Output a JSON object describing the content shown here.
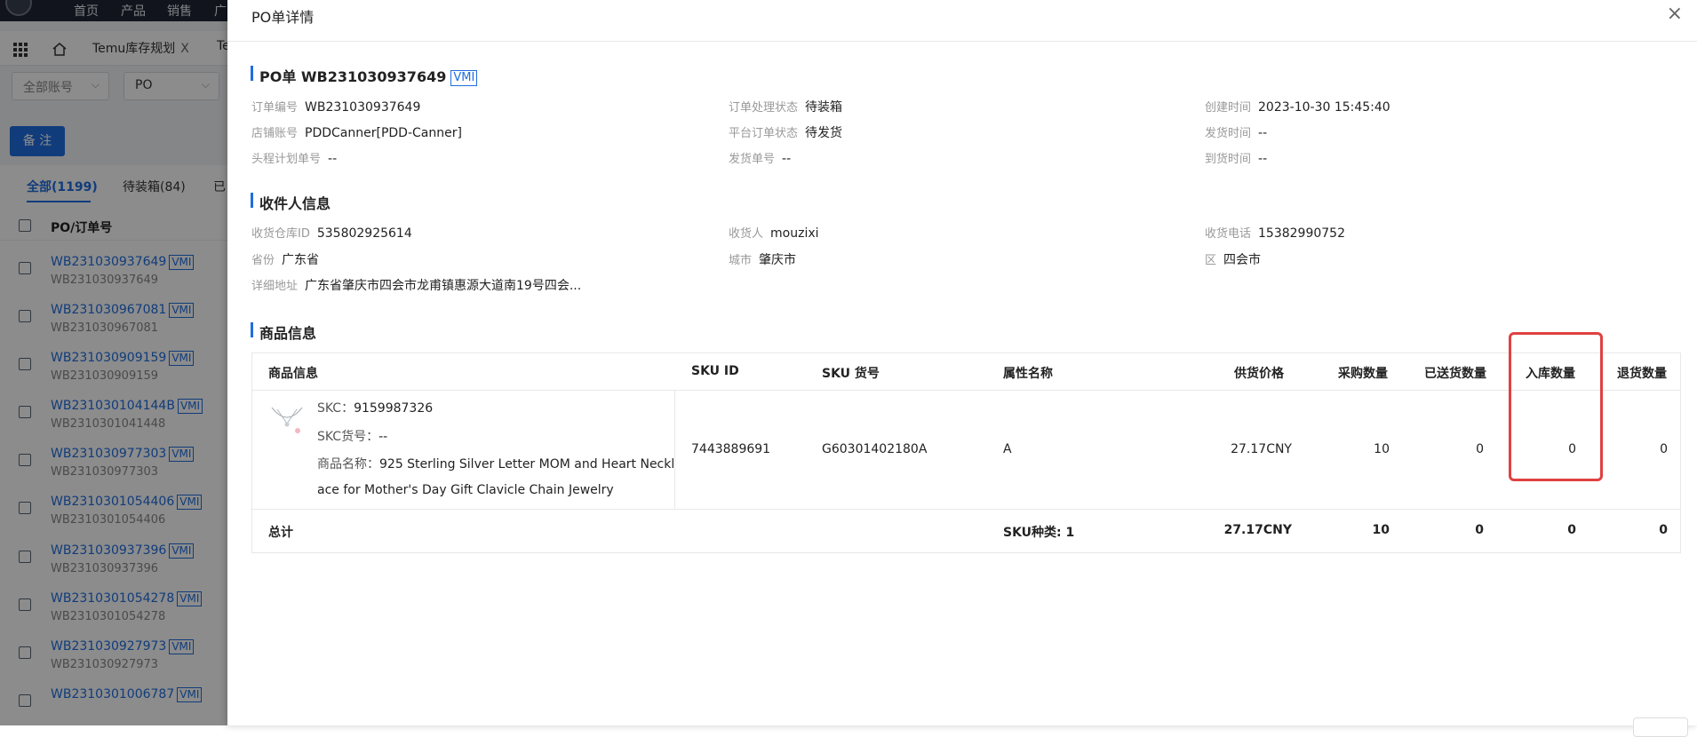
{
  "background": {
    "topnav": [
      "首页",
      "产品",
      "销售",
      "广"
    ],
    "tabs": [
      {
        "label": "Temu库存规划",
        "close": "X"
      },
      {
        "label": "Te"
      }
    ],
    "filters": [
      {
        "label": "全部账号"
      },
      {
        "label": "PO"
      }
    ],
    "note_button": "备 注",
    "status_tabs": [
      {
        "label": "全部(1199)"
      },
      {
        "label": "待装箱(84)"
      },
      {
        "label": "已"
      }
    ],
    "list_header": "PO/订单号",
    "vmi_tag": "VMI",
    "po_list": [
      {
        "po": "WB231030937649",
        "sub": "WB231030937649"
      },
      {
        "po": "WB231030967081",
        "sub": "WB231030967081"
      },
      {
        "po": "WB231030909159",
        "sub": "WB231030909159"
      },
      {
        "po": "WB231030104144B",
        "sub": "WB2310301041448"
      },
      {
        "po": "WB231030977303",
        "sub": "WB231030977303"
      },
      {
        "po": "WB2310301054406",
        "sub": "WB2310301054406"
      },
      {
        "po": "WB231030937396",
        "sub": "WB231030937396"
      },
      {
        "po": "WB2310301054278",
        "sub": "WB2310301054278"
      },
      {
        "po": "WB231030927973",
        "sub": "WB231030927973"
      },
      {
        "po": "WB2310301006787",
        "sub": ""
      }
    ]
  },
  "drawer": {
    "title": "PO单详情",
    "close": "×",
    "po_section": {
      "title": "PO单 WB231030937649",
      "tag": "VMI",
      "fields": [
        {
          "label": "订单编号",
          "value": "WB231030937649"
        },
        {
          "label": "订单处理状态",
          "value": "待装箱"
        },
        {
          "label": "创建时间",
          "value": "2023-10-30 15:45:40"
        },
        {
          "label": "店铺账号",
          "value": "PDDCanner[PDD-Canner]"
        },
        {
          "label": "平台订单状态",
          "value": "待发货"
        },
        {
          "label": "发货时间",
          "value": "--"
        },
        {
          "label": "头程计划单号",
          "value": "--"
        },
        {
          "label": "发货单号",
          "value": "--"
        },
        {
          "label": "到货时间",
          "value": "--"
        }
      ]
    },
    "receiver_section": {
      "title": "收件人信息",
      "fields": [
        {
          "label": "收货仓库ID",
          "value": "535802925614"
        },
        {
          "label": "收货人",
          "value": "mouzixi"
        },
        {
          "label": "收货电话",
          "value": "15382990752"
        },
        {
          "label": "省份",
          "value": "广东省"
        },
        {
          "label": "城市",
          "value": "肇庆市"
        },
        {
          "label": "区",
          "value": "四会市"
        },
        {
          "label": "详细地址",
          "value": "广东省肇庆市四会市龙甫镇惠源大道南19号四会..."
        }
      ]
    },
    "goods_section": {
      "title": "商品信息",
      "headers": [
        "商品信息",
        "SKU ID",
        "SKU 货号",
        "属性名称",
        "供货价格",
        "采购数量",
        "已送货数量",
        "入库数量",
        "退货数量"
      ],
      "row": {
        "skc_label": "SKC：",
        "skc": "9159987326",
        "skc_no_label": "SKC货号：",
        "skc_no": "--",
        "name_label": "商品名称：",
        "name_line1": "925 Sterling Silver Letter MOM and Heart Neckl",
        "name_line2": "ace for Mother's Day Gift Clavicle Chain Jewelry",
        "sku_id": "7443889691",
        "sku_no": "G60301402180A",
        "attr": "A",
        "price": "27.17CNY",
        "purchase_qty": "10",
        "delivered_qty": "0",
        "inbound_qty": "0",
        "return_qty": "0"
      },
      "total": {
        "label": "总计",
        "sku_kinds": "SKU种类: 1",
        "price": "27.17CNY",
        "purchase_qty": "10",
        "delivered_qty": "0",
        "inbound_qty": "0",
        "return_qty": "0"
      }
    }
  }
}
